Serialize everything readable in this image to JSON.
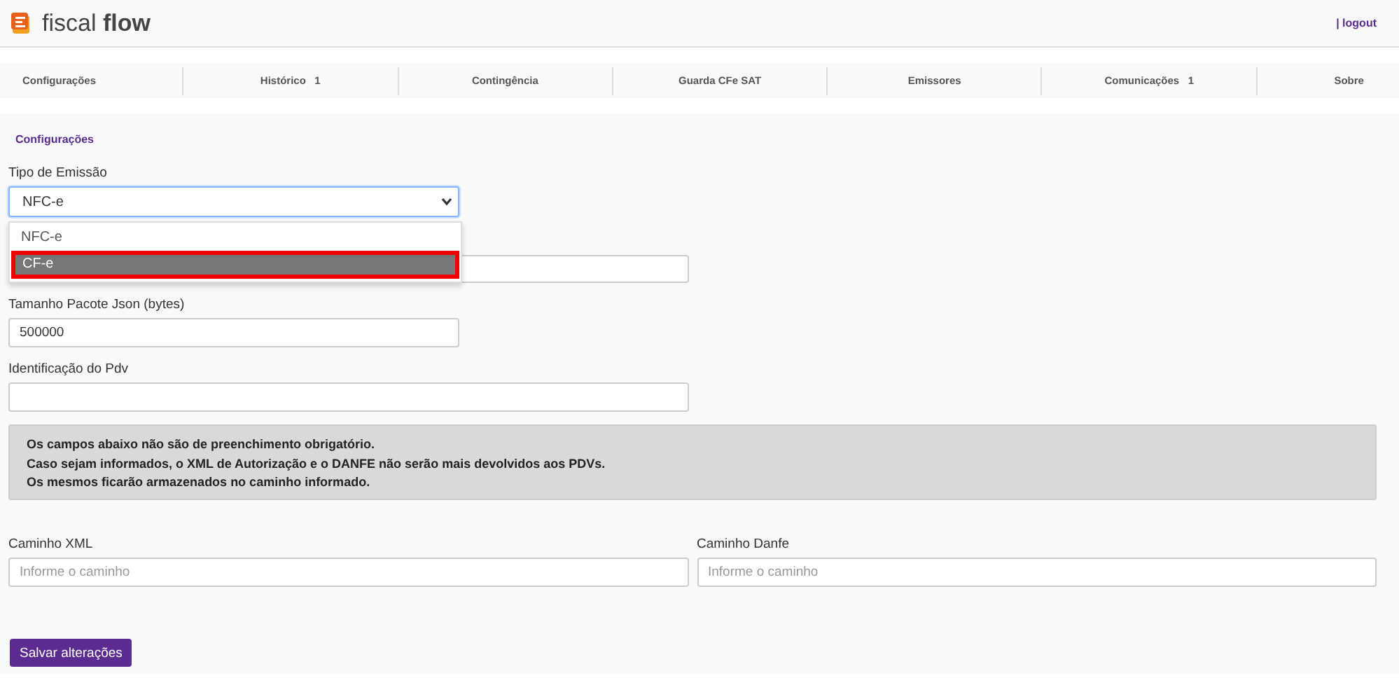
{
  "header": {
    "logo": "fiscal",
    "logo_bold": "flow",
    "logout": "| logout"
  },
  "nav": [
    {
      "label": "Configurações"
    },
    {
      "label": "Histórico",
      "count": "1"
    },
    {
      "label": "Contingência"
    },
    {
      "label": "Guarda CFe SAT"
    },
    {
      "label": "Emissores"
    },
    {
      "label": "Comunicações",
      "count": "1"
    },
    {
      "label": "Sobre"
    }
  ],
  "section_title": "Configurações",
  "tipo_emissao": {
    "label": "Tipo de Emissão",
    "value": "NFC-e",
    "expanded": true,
    "options": [
      {
        "label": "NFC-e",
        "highlighted": false
      },
      {
        "label": "CF-e",
        "highlighted": true
      }
    ]
  },
  "fields": [
    {
      "label": "Tamanho Pacote Json (bytes)",
      "value": "500000"
    },
    {
      "label": "Identificação do Pdv"
    }
  ],
  "notice": [
    "Os campos abaixo não são de preenchimento obrigatório.",
    "Caso sejam informados, o XML de Autorização e o DANFE não serão mais devolvidos aos PDVs.",
    "Os mesmos ficarão armazenados no caminho informado."
  ],
  "paths": [
    {
      "label": "Caminho XML",
      "placeholder": "Informe o caminho"
    },
    {
      "label": "Caminho Danfe",
      "placeholder": "Informe o caminho"
    }
  ],
  "save_button": "Salvar alterações"
}
